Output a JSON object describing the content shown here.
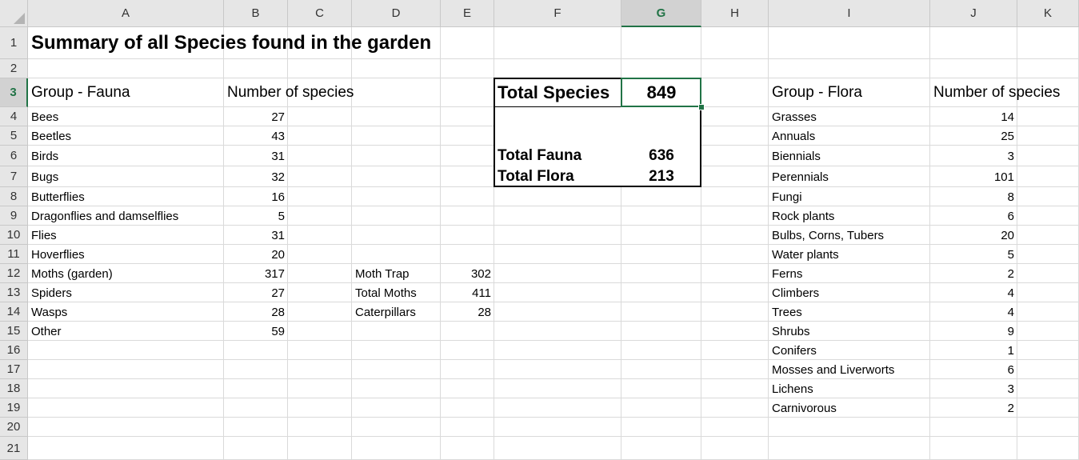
{
  "columns": [
    "A",
    "B",
    "C",
    "D",
    "E",
    "F",
    "G",
    "H",
    "I",
    "J",
    "K"
  ],
  "rows": [
    "1",
    "2",
    "3",
    "4",
    "5",
    "6",
    "7",
    "8",
    "9",
    "10",
    "11",
    "12",
    "13",
    "14",
    "15",
    "16",
    "17",
    "18",
    "19",
    "20",
    "21"
  ],
  "active_column": "G",
  "active_row": "3",
  "title": "Summary of all Species found in the garden",
  "fauna": {
    "group_header": "Group - Fauna",
    "count_header": "Number of species",
    "items": [
      {
        "name": "Bees",
        "count": "27"
      },
      {
        "name": "Beetles",
        "count": "43"
      },
      {
        "name": "Birds",
        "count": "31"
      },
      {
        "name": "Bugs",
        "count": "32"
      },
      {
        "name": "Butterflies",
        "count": "16"
      },
      {
        "name": "Dragonflies and damselflies",
        "count": "5"
      },
      {
        "name": "Flies",
        "count": "31"
      },
      {
        "name": "Hoverflies",
        "count": "20"
      },
      {
        "name": "Moths (garden)",
        "count": "317"
      },
      {
        "name": "Spiders",
        "count": "27"
      },
      {
        "name": "Wasps",
        "count": "28"
      },
      {
        "name": "Other",
        "count": "59"
      }
    ]
  },
  "moths": [
    {
      "label": "Moth Trap",
      "value": "302"
    },
    {
      "label": "Total Moths",
      "value": "411"
    },
    {
      "label": "Caterpillars",
      "value": "28"
    }
  ],
  "totals": {
    "species_label": "Total Species",
    "species_value": "849",
    "fauna_label": "Total Fauna",
    "fauna_value": "636",
    "flora_label": "Total Flora",
    "flora_value": "213"
  },
  "flora": {
    "group_header": "Group - Flora",
    "count_header": "Number of species",
    "items": [
      {
        "name": "Grasses",
        "count": "14"
      },
      {
        "name": "Annuals",
        "count": "25"
      },
      {
        "name": "Biennials",
        "count": "3"
      },
      {
        "name": "Perennials",
        "count": "101"
      },
      {
        "name": "Fungi",
        "count": "8"
      },
      {
        "name": "Rock plants",
        "count": "6"
      },
      {
        "name": "Bulbs, Corns, Tubers",
        "count": "20"
      },
      {
        "name": "Water plants",
        "count": "5"
      },
      {
        "name": "Ferns",
        "count": "2"
      },
      {
        "name": "Climbers",
        "count": "4"
      },
      {
        "name": "Trees",
        "count": "4"
      },
      {
        "name": "Shrubs",
        "count": "9"
      },
      {
        "name": "Conifers",
        "count": "1"
      },
      {
        "name": "Mosses and Liverworts",
        "count": "6"
      },
      {
        "name": "Lichens",
        "count": "3"
      },
      {
        "name": "Carnivorous",
        "count": "2"
      }
    ]
  },
  "colors": {
    "accent": "#217346",
    "header_bg": "#e6e6e6",
    "gridline": "#dadada"
  }
}
